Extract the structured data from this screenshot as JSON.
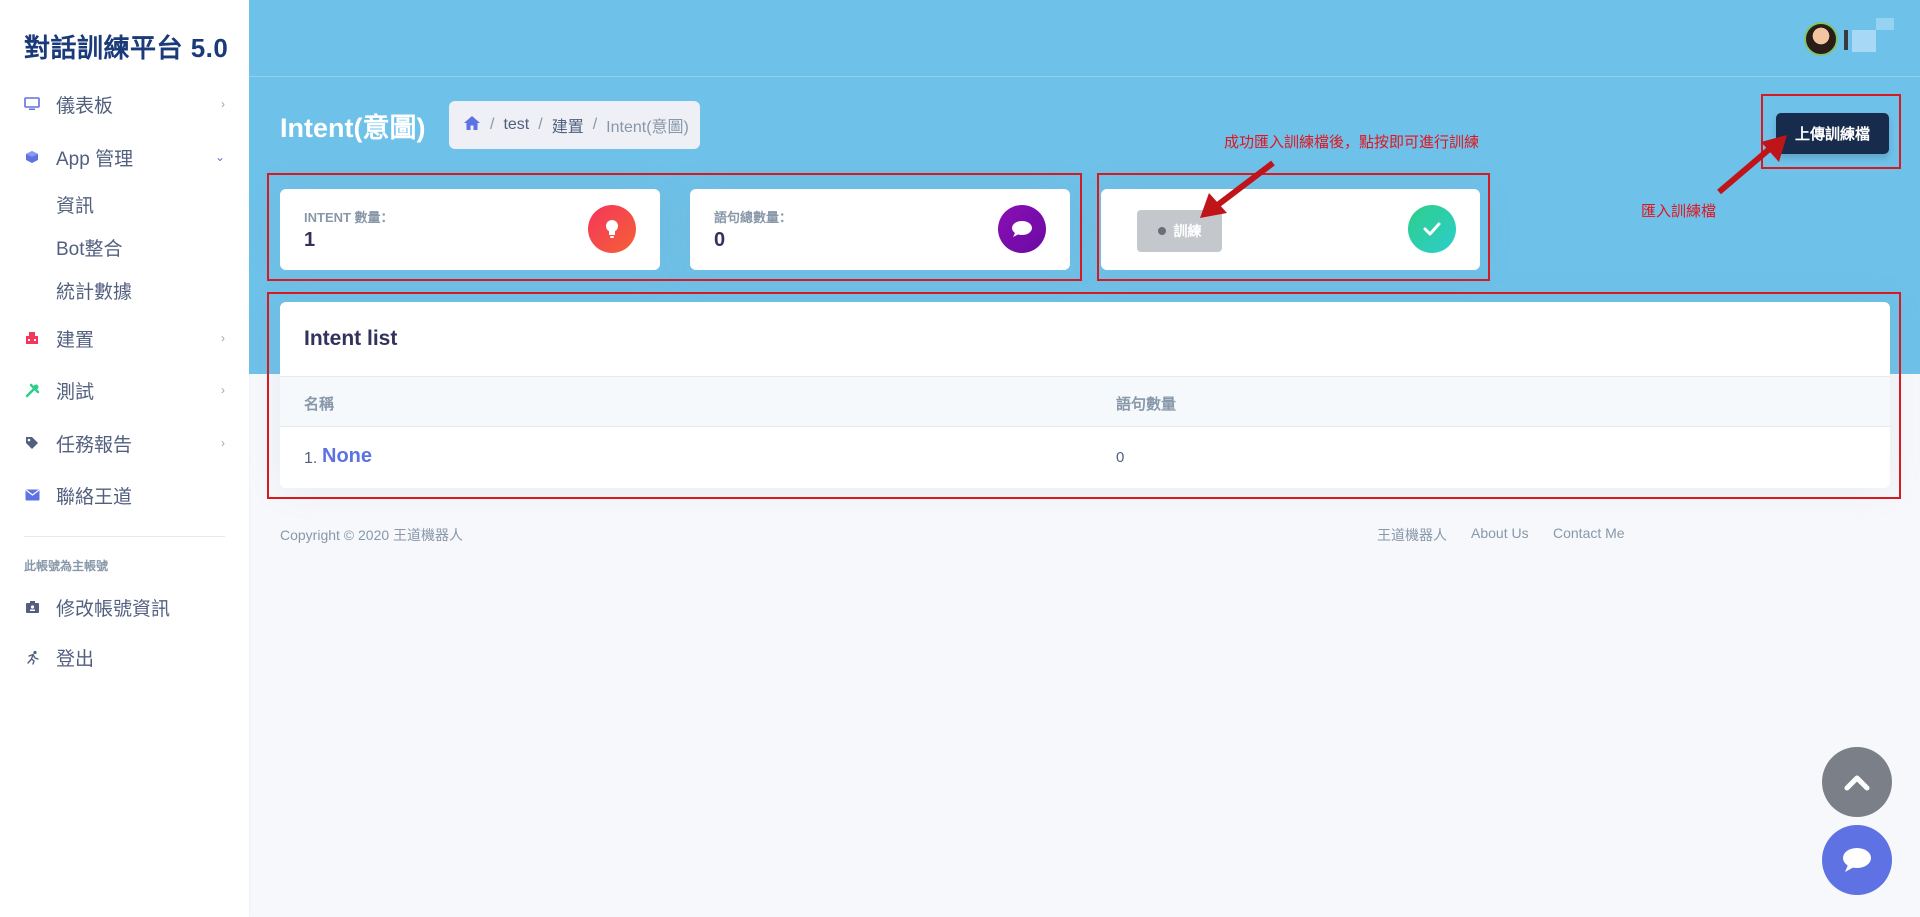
{
  "app": {
    "brand": "對話訓練平台 5.0"
  },
  "sidebar": {
    "items": [
      {
        "label": "儀表板",
        "icon": "monitor-icon"
      },
      {
        "label": "App 管理",
        "icon": "cube-icon"
      },
      {
        "label": "建置",
        "icon": "building-icon"
      },
      {
        "label": "測試",
        "icon": "tools-icon"
      },
      {
        "label": "任務報告",
        "icon": "tag-icon"
      },
      {
        "label": "聯絡王道",
        "icon": "envelope-icon"
      }
    ],
    "subitems": [
      "資訊",
      "Bot整合",
      "統計數據"
    ],
    "account_heading": "此帳號為主帳號",
    "account_items": [
      {
        "label": "修改帳號資訊",
        "icon": "id-card-icon"
      },
      {
        "label": "登出",
        "icon": "running-icon"
      }
    ]
  },
  "header": {
    "title": "Intent(意圖)",
    "breadcrumb": [
      "test",
      "建置",
      "Intent(意圖)"
    ],
    "upload_label": "上傳訓練檔"
  },
  "stats": [
    {
      "label": "INTENT 數量：",
      "value": "1",
      "color": "#f5365c"
    },
    {
      "label": "語句總數量：",
      "value": "0",
      "color": "#8a0fb5"
    }
  ],
  "train": {
    "label": "訓練",
    "check_color": "#2dce89"
  },
  "annotations": {
    "train_hint": "成功匯入訓練檔後，點按即可進行訓練",
    "upload_hint": "匯入訓練檔"
  },
  "intent_list": {
    "title": "Intent list",
    "columns": [
      "名稱",
      "語句數量"
    ],
    "rows": [
      {
        "index": "1.",
        "name": "None",
        "count": "0"
      }
    ]
  },
  "footer": {
    "copyright": "Copyright © 2020 王道機器人",
    "links": [
      "王道機器人",
      "About Us",
      "Contact Me"
    ]
  }
}
